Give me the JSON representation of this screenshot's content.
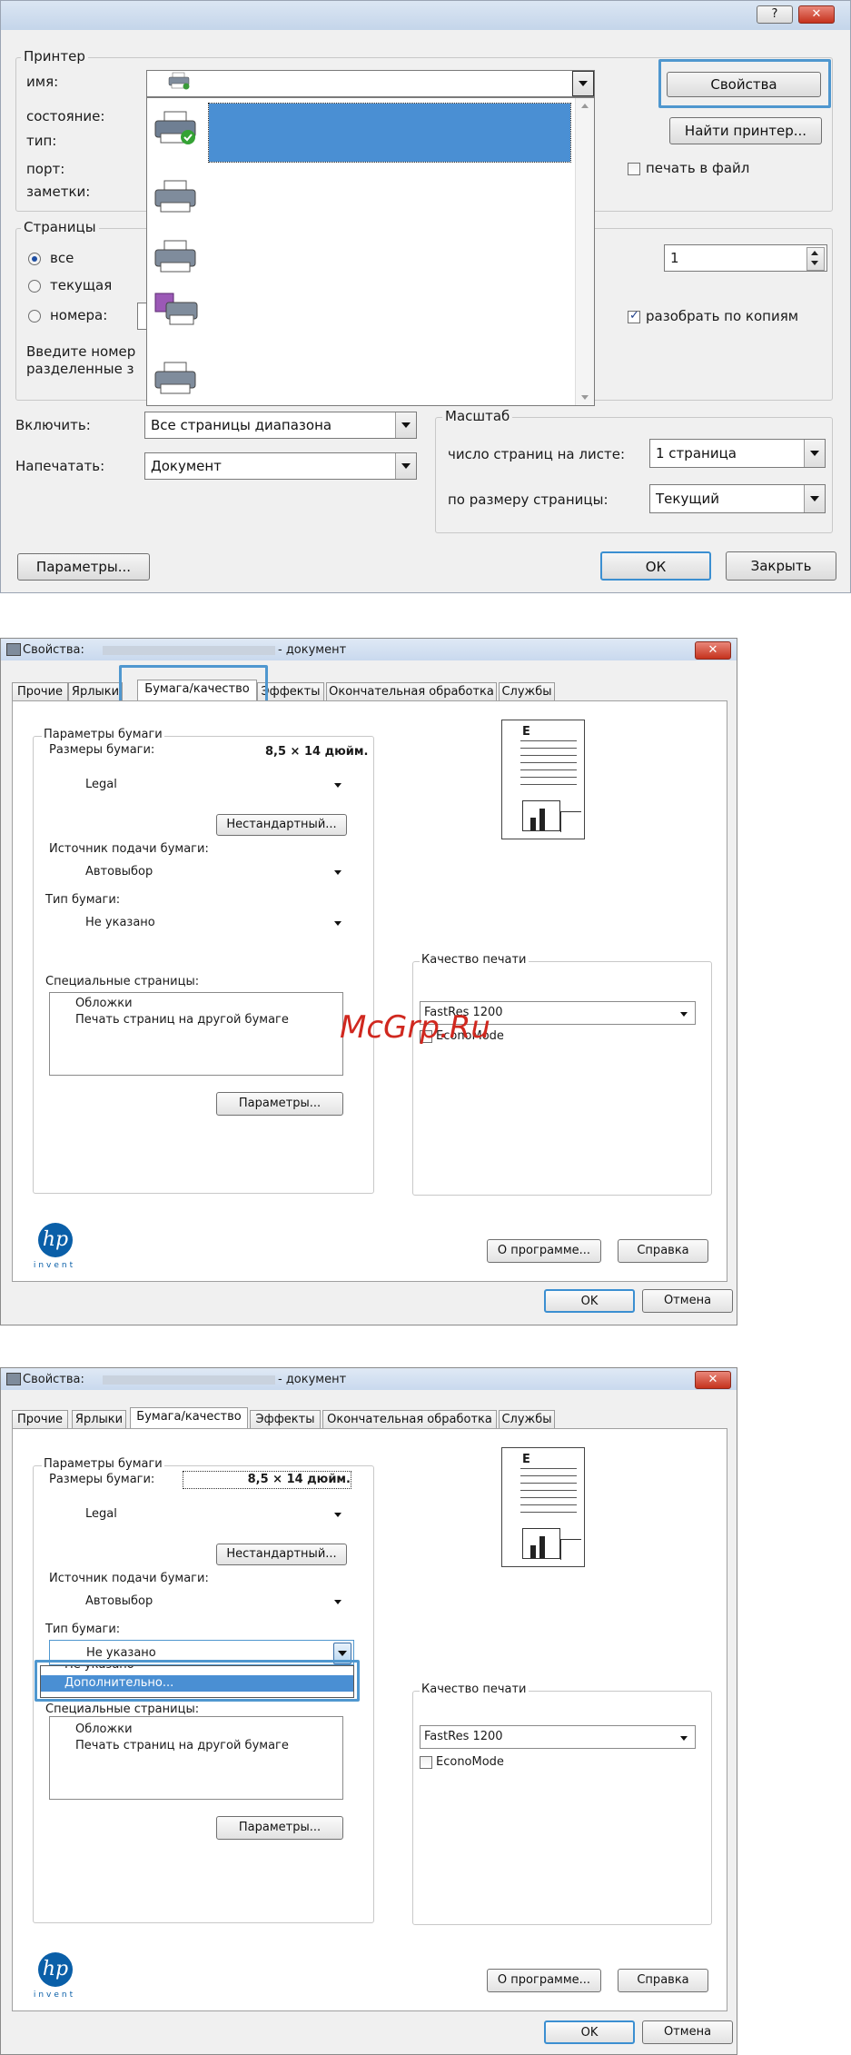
{
  "print_dialog": {
    "help_button": "?",
    "close_button": "✕",
    "printer_group": "Принтер",
    "name_label": "имя:",
    "status_label": "состояние:",
    "type_label": "тип:",
    "port_label": "порт:",
    "notes_label": "заметки:",
    "properties_button": "Свойства",
    "find_printer_button": "Найти принтер...",
    "print_to_file_label": "печать в файл",
    "pages_group": "Страницы",
    "radio_all": "все",
    "radio_current": "текущая",
    "radio_numbers": "номера:",
    "pages_hint_line1": "Введите номер",
    "pages_hint_line2": "разделенные з",
    "copies_value": "1",
    "collate_label": "разобрать по копиям",
    "include_label": "Включить:",
    "include_value": "Все страницы диапазона",
    "print_what_label": "Напечатать:",
    "print_what_value": "Документ",
    "scale_group": "Масштаб",
    "pages_per_sheet_label": "число страниц на листе:",
    "pages_per_sheet_value": "1 страница",
    "fit_label": "по размеру страницы:",
    "fit_value": "Текущий",
    "params_button": "Параметры...",
    "ok_button": "ОК",
    "close_dialog_button": "Закрыть"
  },
  "properties_dialog_1": {
    "title_prefix": "Свойства:",
    "title_suffix": "- документ",
    "close_button": "✕",
    "tabs": [
      "Прочие",
      "Ярлыки",
      "Бумага/качество",
      "Эффекты",
      "Окончательная обработка",
      "Службы"
    ],
    "paper_group": "Параметры бумаги",
    "paper_size_label": "Размеры бумаги:",
    "paper_size_value": "8,5 × 14 дюйм.",
    "paper_size_combo": "Legal",
    "custom_button": "Нестандартный...",
    "source_label": "Источник подачи бумаги:",
    "source_value": "Автовыбор",
    "type_label": "Тип бумаги:",
    "type_value": "Не указано",
    "special_pages_label": "Специальные страницы:",
    "special_items": [
      "Обложки",
      "Печать страниц на другой бумаге"
    ],
    "special_params_button": "Параметры...",
    "quality_group": "Качество печати",
    "quality_value": "FastRes 1200",
    "economode_label": "EconoMode",
    "watermark": "McGrp.Ru",
    "about_button": "О программе...",
    "help_button": "Справка",
    "ok_button": "OK",
    "cancel_button": "Отмена",
    "hp_logo": "hp",
    "hp_invent": "invent"
  },
  "properties_dialog_2": {
    "title_prefix": "Свойства:",
    "title_suffix": "- документ",
    "close_button": "✕",
    "tabs": [
      "Прочие",
      "Ярлыки",
      "Бумага/качество",
      "Эффекты",
      "Окончательная обработка",
      "Службы"
    ],
    "paper_group": "Параметры бумаги",
    "paper_size_label": "Размеры бумаги:",
    "paper_size_value": "8,5 × 14 дюйм.",
    "paper_size_combo": "Legal",
    "custom_button": "Нестандартный...",
    "source_label": "Источник подачи бумаги:",
    "source_value": "Автовыбор",
    "type_label": "Тип бумаги:",
    "type_value": "Не указано",
    "dropdown_items": [
      "Не указано",
      "Дополнительно..."
    ],
    "special_pages_label": "Специальные страницы:",
    "special_items": [
      "Обложки",
      "Печать страниц на другой бумаге"
    ],
    "special_params_button": "Параметры...",
    "quality_group": "Качество печати",
    "quality_value": "FastRes 1200",
    "economode_label": "EconoMode",
    "about_button": "О программе...",
    "help_button": "Справка",
    "ok_button": "OK",
    "cancel_button": "Отмена",
    "hp_logo": "hp",
    "hp_invent": "invent"
  },
  "colors": {
    "selection_blue": "#4a8fd3",
    "highlight_frame": "#4f97cf",
    "close_red": "#c5321d",
    "watermark_red": "#d0281f"
  }
}
